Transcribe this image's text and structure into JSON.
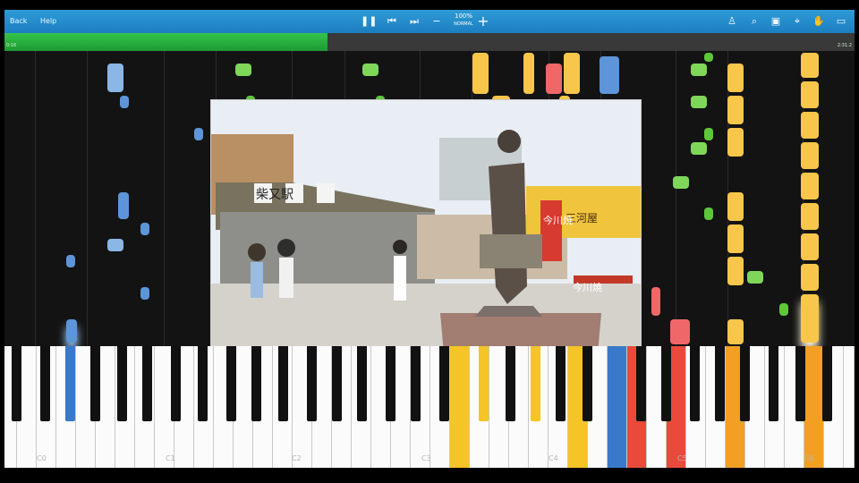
{
  "menu": {
    "back": "Back",
    "help": "Help"
  },
  "toolbar": {
    "zoom": "100%",
    "zoom_sub": "NORMAL",
    "icons": [
      "pause-icon",
      "skip-back-icon",
      "skip-forward-icon",
      "zoom-out-icon",
      "zoom-in-icon",
      "metronome-icon",
      "search-icon",
      "screen-icon",
      "pin-icon",
      "hand-icon",
      "window-icon"
    ]
  },
  "progress": {
    "value": 0.38,
    "time_left": "0:16",
    "time_right": "2:31:2"
  },
  "piano": {
    "octave_labels": [
      "C0",
      "C1",
      "C2",
      "C3",
      "C4",
      "C5",
      "C6"
    ]
  },
  "colors": {
    "blue_note": "#8ab7e6",
    "green_note": "#7fd75a",
    "yellow_note": "#f8c64a",
    "orange_note": "#f4a340",
    "red_note": "#f06767",
    "active_blue": "#3a79c9",
    "active_yellow": "#f5c426",
    "active_orange": "#f29f23",
    "active_red": "#e94a3b",
    "progress_green": "#22b53a",
    "toolbar_blue": "#1e82c8"
  },
  "photo": {
    "station_sign": "柴又駅",
    "shop_sign": "三河屋",
    "banner_1": "今川焼",
    "banner_2": "今川焼"
  }
}
